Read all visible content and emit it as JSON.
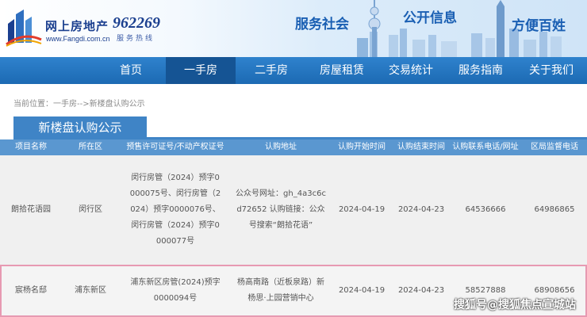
{
  "header": {
    "site_name": "网上房地产",
    "site_url": "www.Fangdi.com.cn",
    "hotline": "962269",
    "hotline_label": "服务热线",
    "slogans": [
      "服务社会",
      "公开信息",
      "方便百姓"
    ]
  },
  "nav": {
    "items": [
      {
        "label": "首页"
      },
      {
        "label": "一手房"
      },
      {
        "label": "二手房"
      },
      {
        "label": "房屋租赁"
      },
      {
        "label": "交易统计"
      },
      {
        "label": "服务指南"
      },
      {
        "label": "关于我们"
      }
    ],
    "active": "一手房"
  },
  "breadcrumb": "当前位置：一手房-->新楼盘认购公示",
  "section_title": "新楼盘认购公示",
  "table": {
    "headers": [
      "项目名称",
      "所在区",
      "预售许可证号/不动产权证号",
      "认购地址",
      "认购开始时间",
      "认购结束时间",
      "认购联系电话/网址",
      "区局监督电话"
    ],
    "rows": [
      {
        "name": "朗拾花语园",
        "district": "闵行区",
        "license_lines": [
          "闵行房管（2024）预字0",
          "000075号、闵行房管（2",
          "024）预字0000076号、",
          "闵行房管（2024）预字0",
          "000077号"
        ],
        "address_lines": [
          "公众号网址：gh_4a3c6c",
          "d72652 认购链接：公众",
          "号搜索“朗拾花语”"
        ],
        "start": "2024-04-19",
        "end": "2024-04-23",
        "phone": "64536666",
        "supervise": "64986865"
      },
      {
        "name": "宸杨名邸",
        "district": "浦东新区",
        "license_lines": [
          "浦东新区房管(2024)预字",
          "0000094号"
        ],
        "address_lines": [
          "杨高南路（近板泉路）新",
          "杨思·上园营销中心"
        ],
        "start": "2024-04-19",
        "end": "2024-04-23",
        "phone": "58527888",
        "supervise": "68908656"
      }
    ]
  },
  "watermark": "搜狐号@搜狐焦点宣城站",
  "colors": {
    "nav_bg": "#2f82cd",
    "nav_active": "#155494",
    "section": "#3f84c6",
    "table_header": "#5a97d0",
    "highlight_border": "#e79ab2"
  }
}
